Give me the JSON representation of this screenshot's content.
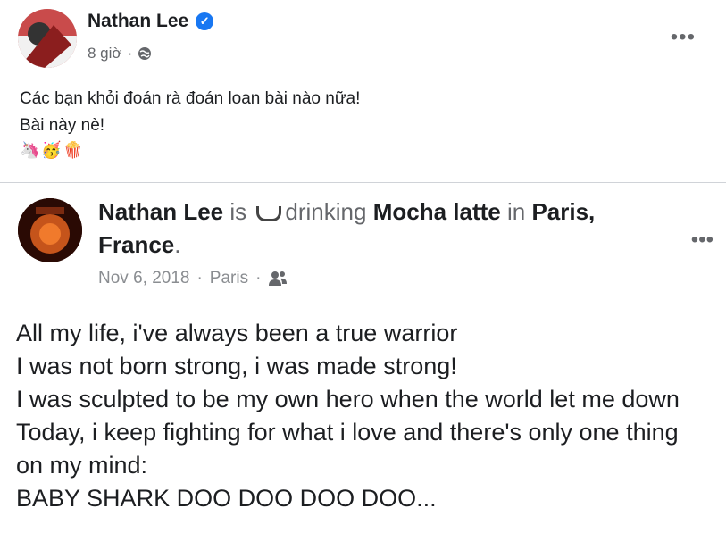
{
  "post": {
    "author": "Nathan Lee",
    "time": "8 giờ",
    "line1": "Các bạn khỏi đoán rà đoán loan bài nào nữa!",
    "line2": "Bài này nè!",
    "emojis": [
      "🦄",
      "🥳",
      "🍿"
    ]
  },
  "shared": {
    "author": "Nathan Lee",
    "is": "is",
    "activity": "drinking",
    "drink": "Mocha latte",
    "in": "in",
    "place": "Paris, France",
    "date": "Nov 6, 2018",
    "location": "Paris",
    "lines": [
      "All my life, i've always been a true warrior",
      "I was not born strong, i was made strong!",
      "I was sculpted to be my own hero when the world let me down",
      "Today, i keep fighting for what i love and there's only one thing on my mind:",
      "BABY SHARK DOO DOO DOO DOO..."
    ]
  },
  "icons": [
    "verified-icon",
    "globe-icon",
    "more-icon",
    "coffee-icon",
    "friends-icon"
  ]
}
